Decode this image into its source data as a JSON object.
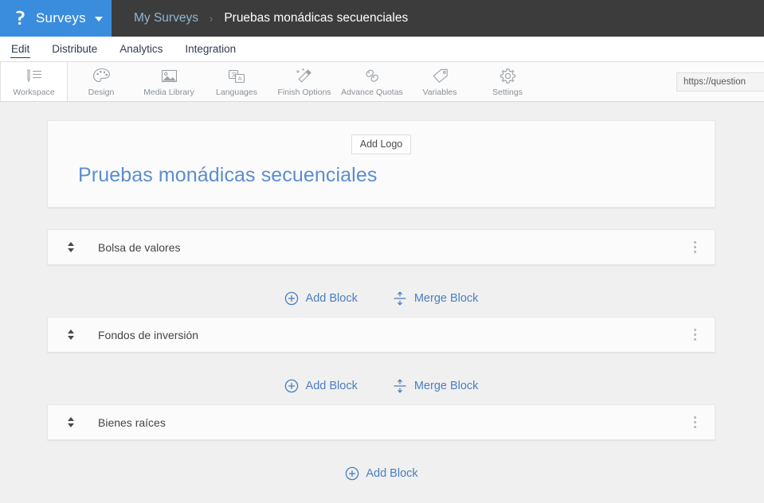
{
  "topbar": {
    "brand_label": "Surveys",
    "brand_logo_icon": "p-question-logo",
    "caret_icon": "chevron-down-icon",
    "breadcrumb": {
      "parent": "My Surveys",
      "separator": "›",
      "current": "Pruebas monádicas secuenciales"
    },
    "brand_color": "#3a8ddd",
    "bar_color": "#3c3c3c"
  },
  "nav": {
    "tabs": [
      {
        "label": "Edit",
        "active": true
      },
      {
        "label": "Distribute",
        "active": false
      },
      {
        "label": "Analytics",
        "active": false
      },
      {
        "label": "Integration",
        "active": false
      }
    ]
  },
  "toolbar": {
    "items": [
      {
        "label": "Workspace",
        "icon": "pencil-list-icon",
        "active": true
      },
      {
        "label": "Design",
        "icon": "palette-icon",
        "active": false
      },
      {
        "label": "Media Library",
        "icon": "image-icon",
        "active": false
      },
      {
        "label": "Languages",
        "icon": "translate-icon",
        "active": false
      },
      {
        "label": "Finish Options",
        "icon": "magic-wand-icon",
        "active": false
      },
      {
        "label": "Advance Quotas",
        "icon": "chain-link-icon",
        "active": false
      },
      {
        "label": "Variables",
        "icon": "tag-icon",
        "active": false
      },
      {
        "label": "Settings",
        "icon": "gear-icon",
        "active": false
      }
    ],
    "url_value": "https://question"
  },
  "survey": {
    "add_logo_label": "Add Logo",
    "title": "Pruebas monádicas secuenciales",
    "title_color": "#5b8dd0",
    "blocks": [
      {
        "label": "Bolsa de valores"
      },
      {
        "label": "Fondos de inversión"
      },
      {
        "label": "Bienes raíces"
      }
    ],
    "add_block_label": "Add Block",
    "merge_block_label": "Merge Block",
    "add_block_icon": "circle-plus-icon",
    "merge_block_icon": "merge-arrows-icon",
    "sort_handle_icon": "sort-updown-icon",
    "kebab_icon": "more-vertical-icon",
    "link_color": "#4a7fc1"
  }
}
